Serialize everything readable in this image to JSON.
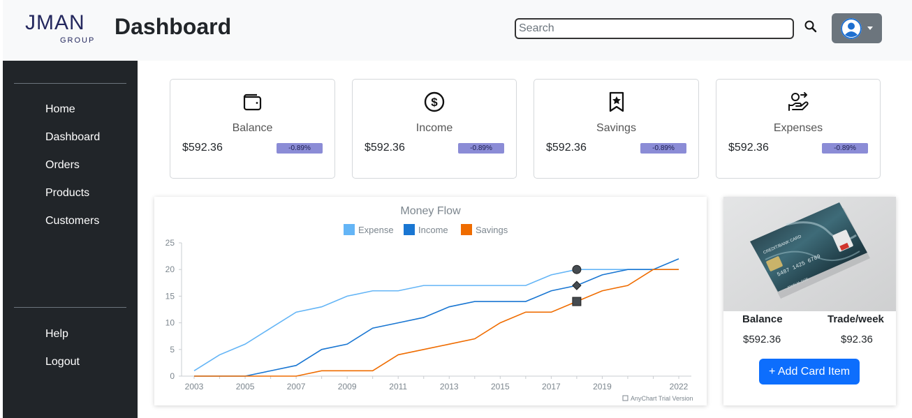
{
  "header": {
    "logo_main": "JMAN",
    "logo_sub": "GROUP",
    "title": "Dashboard",
    "search_placeholder": "Search"
  },
  "sidebar": {
    "items": [
      {
        "label": "Home"
      },
      {
        "label": "Dashboard"
      },
      {
        "label": "Orders"
      },
      {
        "label": "Products"
      },
      {
        "label": "Customers"
      }
    ],
    "bottom_items": [
      {
        "label": "Help"
      },
      {
        "label": "Logout"
      }
    ]
  },
  "stats": [
    {
      "icon": "wallet-icon",
      "title": "Balance",
      "value": "$592.36",
      "change": "-0.89%"
    },
    {
      "icon": "dollar-circle-icon",
      "title": "Income",
      "value": "$592.36",
      "change": "-0.89%"
    },
    {
      "icon": "bookmark-star-icon",
      "title": "Savings",
      "value": "$592.36",
      "change": "-0.89%"
    },
    {
      "icon": "hand-money-icon",
      "title": "Expenses",
      "value": "$592.36",
      "change": "-0.89%"
    }
  ],
  "chart_data": {
    "type": "line",
    "title": "Money Flow",
    "xlabel": "",
    "ylabel": "",
    "x": [
      2003,
      2004,
      2005,
      2006,
      2007,
      2008,
      2009,
      2010,
      2011,
      2012,
      2013,
      2014,
      2015,
      2016,
      2017,
      2018,
      2019,
      2020,
      2021,
      2022
    ],
    "x_ticks": [
      "2003",
      "2005",
      "2007",
      "2009",
      "2011",
      "2013",
      "2015",
      "2017",
      "2019",
      "2022"
    ],
    "ylim": [
      0,
      25
    ],
    "y_ticks": [
      "0",
      "5",
      "10",
      "15",
      "20",
      "25"
    ],
    "legend_position": "top",
    "series": [
      {
        "name": "Expense",
        "color": "#64b5f6",
        "marker": "circle",
        "values": [
          1,
          4,
          6,
          9,
          12,
          13,
          15,
          16,
          16,
          17,
          17,
          17,
          17,
          17,
          19,
          20,
          20,
          20,
          20,
          20
        ]
      },
      {
        "name": "Income",
        "color": "#1976d2",
        "marker": "diamond",
        "values": [
          0,
          0,
          0,
          1,
          2,
          5,
          6,
          9,
          10,
          11,
          13,
          14,
          14,
          14,
          16,
          17,
          19,
          20,
          20,
          22
        ]
      },
      {
        "name": "Savings",
        "color": "#ef6c00",
        "marker": "square",
        "values": [
          0,
          0,
          0,
          0,
          0,
          1,
          1,
          1,
          4,
          5,
          6,
          7,
          10,
          12,
          12,
          14,
          16,
          17,
          20,
          20
        ]
      }
    ],
    "highlight_x": 2018,
    "credit": "AnyChart Trial Version"
  },
  "card_panel": {
    "balance_label": "Balance",
    "trade_label": "Trade/week",
    "balance_value": "$592.36",
    "trade_value": "$92.36",
    "add_button": "+ Add Card Item",
    "card_texts": {
      "title": "CREDIT/BANK CARD",
      "number": "5487 1425 6789",
      "holder": "JOHN M. DOE"
    }
  }
}
